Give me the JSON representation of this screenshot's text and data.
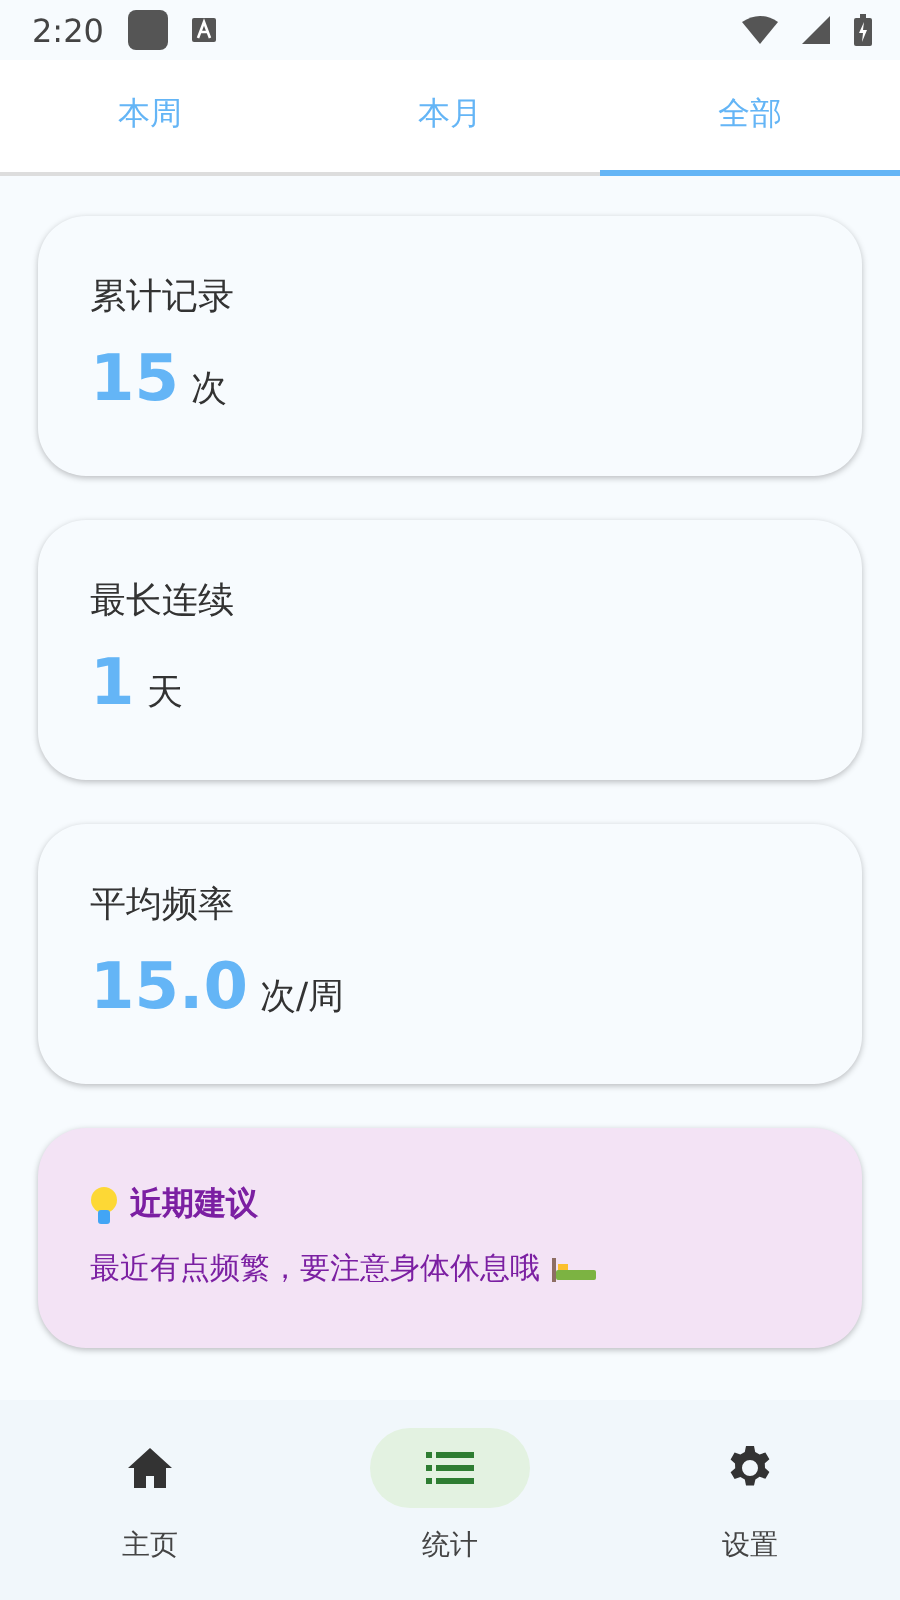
{
  "status_bar": {
    "time": "2:20"
  },
  "tabs": [
    {
      "label": "本周",
      "selected": false
    },
    {
      "label": "本月",
      "selected": false
    },
    {
      "label": "全部",
      "selected": true
    }
  ],
  "stats": [
    {
      "label": "累计记录",
      "value": "15",
      "unit": "次"
    },
    {
      "label": "最长连续",
      "value": "1",
      "unit": "天"
    },
    {
      "label": "平均频率",
      "value": "15.0",
      "unit": "次/周"
    }
  ],
  "suggestion": {
    "title": "近期建议",
    "text": "最近有点频繁，要注意身体休息哦"
  },
  "bottom_nav": [
    {
      "kind": "home",
      "label": "主页",
      "selected": false
    },
    {
      "kind": "stats",
      "label": "统计",
      "selected": true
    },
    {
      "kind": "settings",
      "label": "设置",
      "selected": false
    }
  ]
}
